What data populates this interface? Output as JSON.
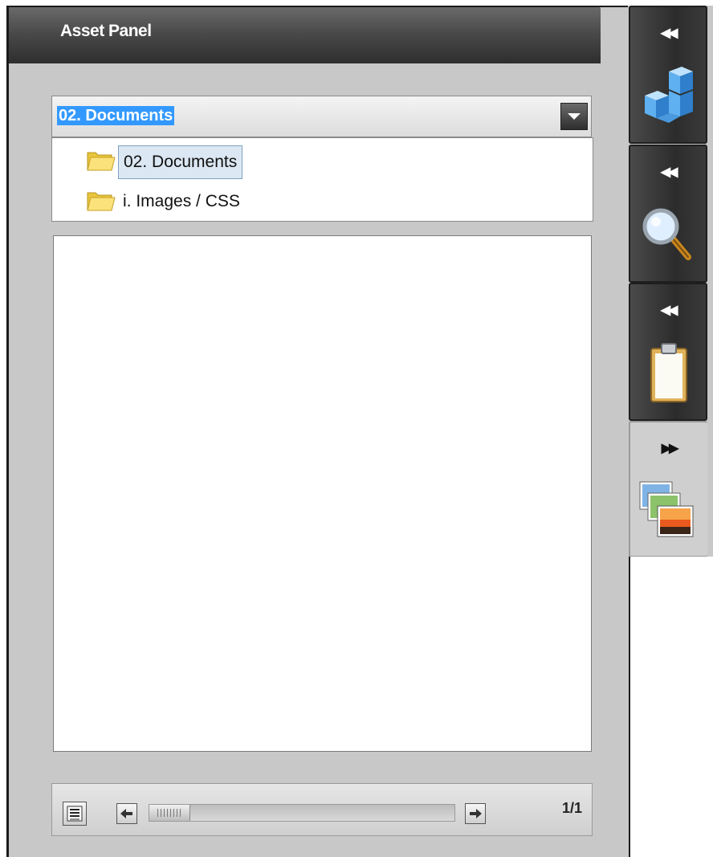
{
  "panel": {
    "title": "Asset Panel"
  },
  "folder_select": {
    "selected_value": "02. Documents",
    "options": [
      "02. Documents",
      "i. Images / CSS"
    ]
  },
  "tree": {
    "items": [
      {
        "label": "02. Documents",
        "selected": true
      },
      {
        "label": "i. Images / CSS",
        "selected": false
      }
    ]
  },
  "pager": {
    "page_label": "1/1"
  },
  "dock": {
    "tabs": [
      {
        "name": "components",
        "collapse_glyph": "◀◀",
        "icon": "cubes-icon"
      },
      {
        "name": "search",
        "collapse_glyph": "◀◀",
        "icon": "magnifier-icon"
      },
      {
        "name": "clipboard",
        "collapse_glyph": "◀◀",
        "icon": "clipboard-icon"
      },
      {
        "name": "assets",
        "collapse_glyph": "▶▶",
        "icon": "images-icon",
        "active": true
      }
    ]
  },
  "colors": {
    "header_dark": "#2e2e2e",
    "selection_blue": "#3399ff",
    "panel_gray": "#c8c8c8"
  }
}
